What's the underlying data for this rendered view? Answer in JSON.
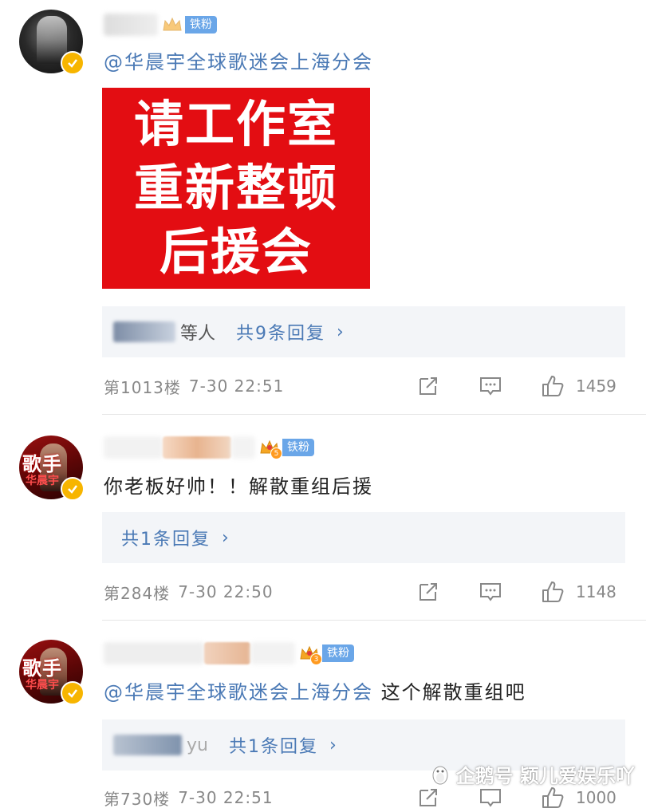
{
  "comments": [
    {
      "user_badge": "铁粉",
      "mention": "@华晨宇全球歌迷会上海分会",
      "text": "",
      "image_lines": [
        "请工作室",
        "重新整顿",
        "后援会"
      ],
      "reply_suffix": "等人",
      "reply_link": "共9条回复",
      "floor": "第1013楼",
      "time": "7-30 22:51",
      "likes": "1459"
    },
    {
      "user_badge": "铁粉",
      "crown_level": "5",
      "mention": "",
      "text": "你老板好帅！！解散重组后援",
      "reply_suffix": "",
      "reply_link": "共1条回复",
      "floor": "第284楼",
      "time": "7-30 22:50",
      "likes": "1148"
    },
    {
      "user_badge": "铁粉",
      "crown_level": "3",
      "mention": "@华晨宇全球歌迷会上海分会",
      "text": " 这个解散重组吧",
      "reply_suffix": "yu",
      "reply_link": "共1条回复",
      "floor": "第730楼",
      "time": "7-30 22:51",
      "likes": "1000"
    }
  ],
  "avatar_text": {
    "mark": "歌手",
    "mark2": "华晨宇"
  },
  "watermark": "企鹅号 颖儿爱娱乐吖",
  "colors": {
    "accent": "#4a79b5",
    "red_image": "#e30d12",
    "badge": "#6aa6e8",
    "verified": "#f7b500"
  }
}
